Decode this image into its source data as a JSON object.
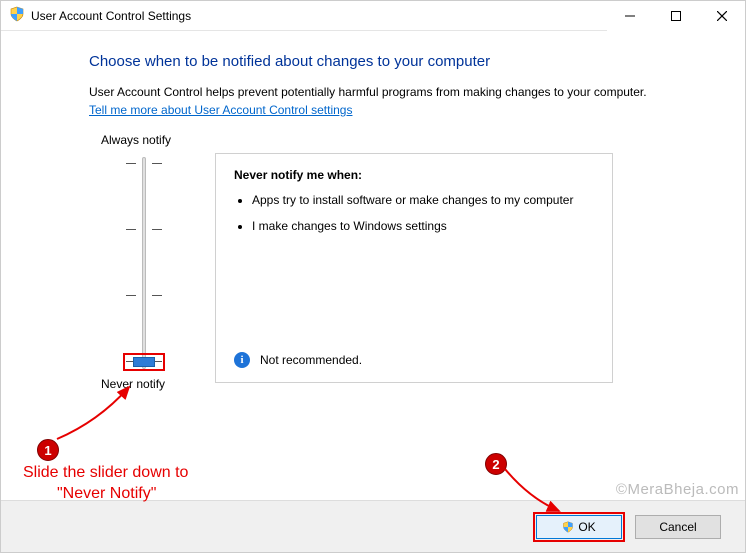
{
  "titlebar": {
    "title": "User Account Control Settings"
  },
  "heading": "Choose when to be notified about changes to your computer",
  "sub": "User Account Control helps prevent potentially harmful programs from making changes to your computer.",
  "link": "Tell me more about User Account Control settings",
  "slider": {
    "top_label": "Always notify",
    "bottom_label": "Never notify"
  },
  "desc": {
    "title": "Never notify me when:",
    "bullets": [
      "Apps try to install software or make changes to my computer",
      "I make changes to Windows settings"
    ],
    "recommendation": "Not recommended."
  },
  "buttons": {
    "ok": "OK",
    "cancel": "Cancel"
  },
  "annotations": {
    "badge1": "1",
    "badge2": "2",
    "text1a": "Slide the slider down to",
    "text1b": "\"Never Notify\""
  },
  "watermark": "©MeraBheja.com"
}
